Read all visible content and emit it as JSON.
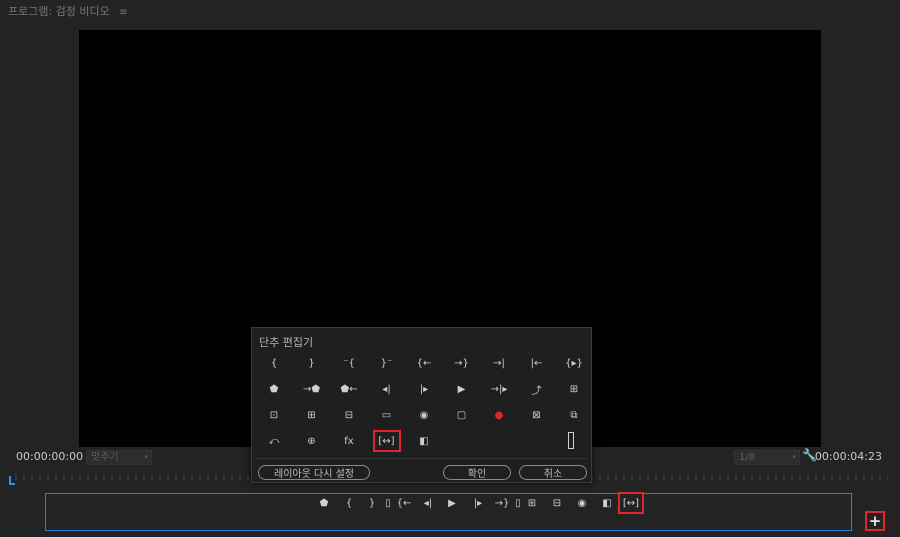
{
  "panel": {
    "title": "프로그램: 검정 비디오",
    "menu_glyph": "≡"
  },
  "timecode": {
    "current": "00:00:00:00",
    "duration": "00:00:04:23"
  },
  "fit_dropdown": {
    "value": "맞추기",
    "caret": "▾"
  },
  "resolution_dropdown": {
    "value": "1/8",
    "caret": "▾"
  },
  "settings_icon_glyph": "🔧",
  "button_bar": {
    "buttons": [
      {
        "name": "add-marker-icon",
        "glyph": "⬟"
      },
      {
        "name": "mark-in-icon",
        "glyph": "{"
      },
      {
        "name": "mark-out-icon",
        "glyph": "}"
      },
      {
        "name": "spacer-icon",
        "glyph": "▯"
      },
      {
        "name": "go-to-in-icon",
        "glyph": "{←"
      },
      {
        "name": "step-back-icon",
        "glyph": "◂|"
      },
      {
        "name": "play-icon",
        "glyph": "▶"
      },
      {
        "name": "step-forward-icon",
        "glyph": "|▸"
      },
      {
        "name": "go-to-out-icon",
        "glyph": "→}"
      },
      {
        "name": "spacer-icon",
        "glyph": "▯"
      },
      {
        "name": "lift-icon",
        "glyph": "⊞"
      },
      {
        "name": "extract-icon",
        "glyph": "⊟"
      },
      {
        "name": "export-frame-icon",
        "glyph": "◉"
      },
      {
        "name": "comparison-view-icon",
        "glyph": "◧"
      },
      {
        "name": "proxy-toggle-icon",
        "glyph": "[↔]"
      }
    ],
    "add_button_glyph": "+"
  },
  "dialog": {
    "title": "단추 편집기",
    "rows": [
      [
        {
          "name": "mark-in-icon",
          "glyph": "{"
        },
        {
          "name": "mark-out-icon",
          "glyph": "}"
        },
        {
          "name": "mark-clip-in-icon",
          "glyph": "⁻{"
        },
        {
          "name": "mark-clip-out-icon",
          "glyph": "}⁻"
        },
        {
          "name": "go-to-in-icon",
          "glyph": "{←"
        },
        {
          "name": "go-to-out-icon",
          "glyph": "→}"
        },
        {
          "name": "go-to-next-edit-icon",
          "glyph": "→|"
        },
        {
          "name": "go-to-prev-edit-icon",
          "glyph": "|←"
        },
        {
          "name": "play-in-to-out-icon",
          "glyph": "{▸}"
        }
      ],
      [
        {
          "name": "add-marker-icon",
          "glyph": "⬟"
        },
        {
          "name": "go-to-next-marker-icon",
          "glyph": "→⬟"
        },
        {
          "name": "go-to-prev-marker-icon",
          "glyph": "⬟←"
        },
        {
          "name": "step-back-icon",
          "glyph": "◂|"
        },
        {
          "name": "step-forward-icon",
          "glyph": "|▸"
        },
        {
          "name": "play-icon",
          "glyph": "▶"
        },
        {
          "name": "play-around-icon",
          "glyph": "→|▸"
        },
        {
          "name": "loop-playback-icon",
          "glyph": "⤴"
        },
        {
          "name": "insert-icon",
          "glyph": "⊞"
        }
      ],
      [
        {
          "name": "overwrite-icon",
          "glyph": "⊡"
        },
        {
          "name": "lift-icon",
          "glyph": "⊞"
        },
        {
          "name": "extract-icon",
          "glyph": "⊟"
        },
        {
          "name": "safe-margins-icon",
          "glyph": "▭"
        },
        {
          "name": "export-frame-icon",
          "glyph": "◉"
        },
        {
          "name": "captions-icon",
          "glyph": "▢"
        },
        {
          "name": "record-icon",
          "glyph": "●"
        },
        {
          "name": "multi-camera-icon",
          "glyph": "⊠"
        },
        {
          "name": "vr-video-icon",
          "glyph": "⧉"
        }
      ],
      [
        {
          "name": "restore-crop-icon",
          "glyph": "⤺"
        },
        {
          "name": "global-fx-mute-icon",
          "glyph": "⊕"
        },
        {
          "name": "fx-icon",
          "glyph": "fx"
        },
        {
          "name": "proxy-toggle-icon",
          "glyph": "[↔]"
        },
        {
          "name": "comparison-view-icon",
          "glyph": "◧"
        }
      ]
    ],
    "reset_label": "레이아웃 다시 설정",
    "ok_label": "확인",
    "cancel_label": "취소"
  }
}
